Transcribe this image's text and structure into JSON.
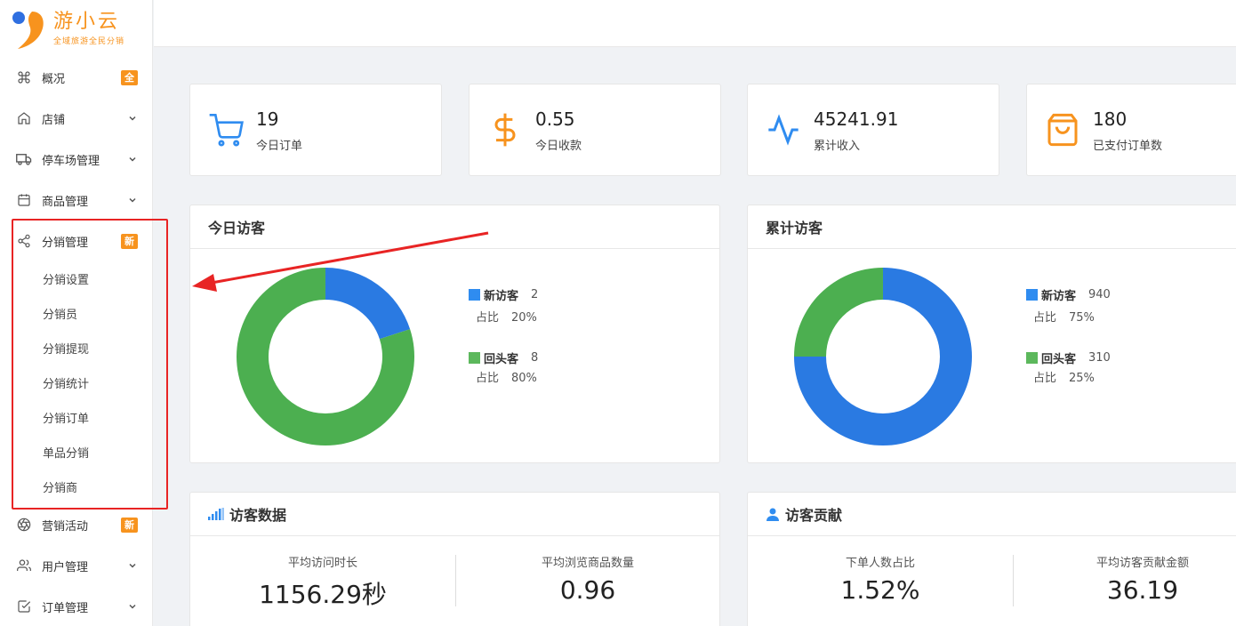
{
  "brand": {
    "title": "游小云",
    "subtitle": "全域旅游全民分销"
  },
  "sidebar": {
    "items": [
      {
        "label": "概况",
        "icon": "command-icon",
        "badge": "全"
      },
      {
        "label": "店铺",
        "icon": "home-icon"
      },
      {
        "label": "停车场管理",
        "icon": "truck-icon"
      },
      {
        "label": "商品管理",
        "icon": "calendar-icon"
      },
      {
        "label": "分销管理",
        "icon": "share-icon",
        "badge": "新",
        "children": [
          "分销设置",
          "分销员",
          "分销提现",
          "分销统计",
          "分销订单",
          "单品分销",
          "分销商"
        ]
      },
      {
        "label": "营销活动",
        "icon": "aperture-icon",
        "badge": "新"
      },
      {
        "label": "用户管理",
        "icon": "users-icon"
      },
      {
        "label": "订单管理",
        "icon": "check-square-icon"
      }
    ]
  },
  "stats": [
    {
      "value": "19",
      "label": "今日订单",
      "icon": "cart-icon",
      "color": "#2f8cf0"
    },
    {
      "value": "0.55",
      "label": "今日收款",
      "icon": "dollar-icon",
      "color": "#f7931e"
    },
    {
      "value": "45241.91",
      "label": "累计收入",
      "icon": "activity-icon",
      "color": "#2f8cf0"
    },
    {
      "value": "180",
      "label": "已支付订单数",
      "icon": "bag-icon",
      "color": "#f7931e"
    }
  ],
  "today_visitors": {
    "title": "今日访客",
    "new": {
      "name": "新访客",
      "value": "2",
      "pct_label": "占比",
      "pct": "20%",
      "fraction": 0.2
    },
    "returning": {
      "name": "回头客",
      "value": "8",
      "pct_label": "占比",
      "pct": "80%",
      "fraction": 0.8
    }
  },
  "total_visitors": {
    "title": "累计访客",
    "new": {
      "name": "新访客",
      "value": "940",
      "pct_label": "占比",
      "pct": "75%",
      "fraction": 0.75
    },
    "returning": {
      "name": "回头客",
      "value": "310",
      "pct_label": "占比",
      "pct": "25%",
      "fraction": 0.25
    }
  },
  "visitor_data": {
    "title": "访客数据",
    "metrics": [
      {
        "label": "平均访问时长",
        "value": "1156.29秒"
      },
      {
        "label": "平均浏览商品数量",
        "value": "0.96"
      }
    ]
  },
  "visitor_contribution": {
    "title": "访客贡献",
    "metrics": [
      {
        "label": "下单人数占比",
        "value": "1.52%"
      },
      {
        "label": "平均访客贡献金额",
        "value": "36.19"
      }
    ]
  },
  "colors": {
    "blue": "#2a7ae2",
    "green": "#4caf50",
    "orange": "#f7931e",
    "annotation": "#e82424",
    "legend_blue": "#2f8cf0",
    "legend_green": "#5cb85c"
  }
}
